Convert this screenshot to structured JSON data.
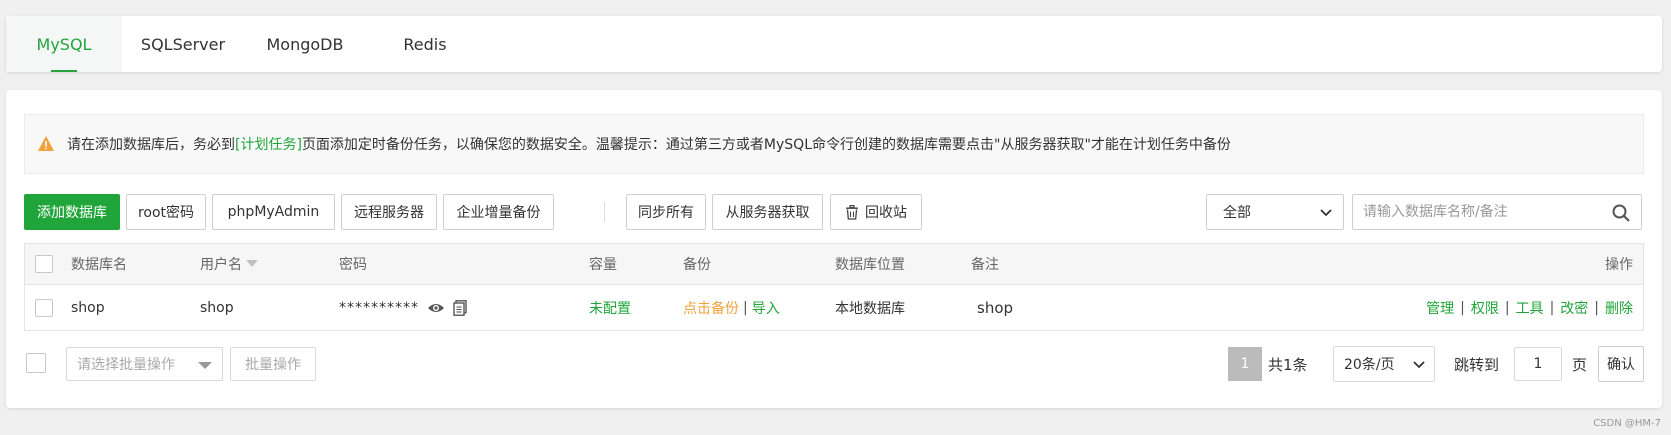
{
  "tabs": [
    {
      "label": "MySQL",
      "active": true
    },
    {
      "label": "SQLServer",
      "active": false
    },
    {
      "label": "MongoDB",
      "active": false
    },
    {
      "label": "Redis",
      "active": false
    }
  ],
  "alert": {
    "text_before": "请在添加数据库后，务必到",
    "link": "[计划任务]",
    "text_after": "页面添加定时备份任务，以确保您的数据安全。温馨提示：通过第三方或者MySQL命令行创建的数据库需要点击\"从服务器获取\"才能在计划任务中备份"
  },
  "toolbar": {
    "add_db": "添加数据库",
    "root_pwd": "root密码",
    "phpmyadmin": "phpMyAdmin",
    "remote": "远程服务器",
    "incremental": "企业增量备份",
    "sync_all": "同步所有",
    "fetch": "从服务器获取",
    "recycle": "回收站",
    "filter_value": "全部",
    "search_placeholder": "请输入数据库名称/备注"
  },
  "table": {
    "headers": {
      "name": "数据库名",
      "user": "用户名",
      "password": "密码",
      "capacity": "容量",
      "backup": "备份",
      "location": "数据库位置",
      "note": "备注",
      "actions": "操作"
    },
    "rows": [
      {
        "name": "shop",
        "user": "shop",
        "password": "**********",
        "capacity": "未配置",
        "backup_action": "点击备份",
        "import_action": "导入",
        "location": "本地数据库",
        "note": "shop",
        "actions": [
          "管理",
          "权限",
          "工具",
          "改密",
          "删除"
        ]
      }
    ]
  },
  "footer": {
    "batch_placeholder": "请选择批量操作",
    "batch_button": "批量操作",
    "current_page": "1",
    "total": "共1条",
    "per_page": "20条/页",
    "goto_label": "跳转到",
    "goto_value": "1",
    "page_suffix": "页",
    "confirm": "确认"
  },
  "watermark": "CSDN @HM-7",
  "colors": {
    "accent": "#20a53a",
    "warning": "#f0a13a"
  }
}
